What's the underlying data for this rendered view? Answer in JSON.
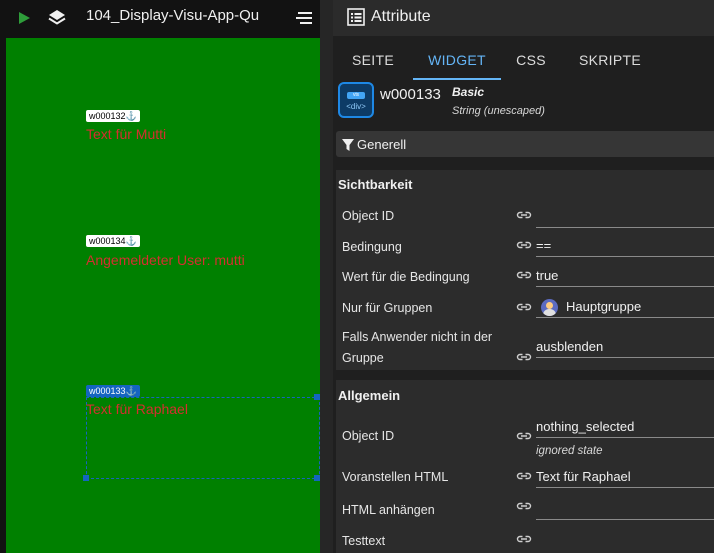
{
  "left_toolbar": {
    "project_title": "104_Display-Visu-App-Qu",
    "icons": [
      "play-icon",
      "layers-icon",
      "menu-lines-icon"
    ]
  },
  "canvas": {
    "background": "#008000",
    "widgets": [
      {
        "id": "w000132",
        "anchor": "⚓",
        "text": "Text für Mutti"
      },
      {
        "id": "w000134",
        "anchor": "⚓",
        "text": "Angemeldeter User: mutti"
      },
      {
        "id": "w000133",
        "anchor": "⚓",
        "text": "Text für Raphael",
        "selected": true
      }
    ]
  },
  "attributes": {
    "title": "Attribute",
    "tabs": [
      {
        "label": "SEITE",
        "active": false
      },
      {
        "label": "WIDGET",
        "active": true
      },
      {
        "label": "CSS",
        "active": false
      },
      {
        "label": "SKRIPTE",
        "active": false
      }
    ],
    "widget": {
      "icon_top": "vis",
      "icon_bottom": "<div>",
      "id": "w000133",
      "set": "Basic",
      "type": "String (unescaped)"
    },
    "group_filter": {
      "label": "Generell"
    },
    "sichtbarkeit": {
      "title": "Sichtbarkeit",
      "rows": [
        {
          "label": "Object ID",
          "value": ""
        },
        {
          "label": "Bedingung",
          "value": "=="
        },
        {
          "label": "Wert für die Bedingung",
          "value": "true"
        },
        {
          "label": "Nur für Gruppen",
          "value": "Hauptgruppe"
        },
        {
          "label_line1": "Falls Anwender nicht in der",
          "label_line2": "Gruppe",
          "value": "ausblenden"
        }
      ]
    },
    "allgemein": {
      "title": "Allgemein",
      "rows": [
        {
          "label": "Object ID",
          "value": "nothing_selected",
          "hint": "ignored state"
        },
        {
          "label": "Voranstellen HTML",
          "value": "Text für Raphael"
        },
        {
          "label": "HTML anhängen",
          "value": ""
        },
        {
          "label": "Testtext",
          "value": ""
        }
      ]
    },
    "accent_color": "#64b5f6"
  }
}
